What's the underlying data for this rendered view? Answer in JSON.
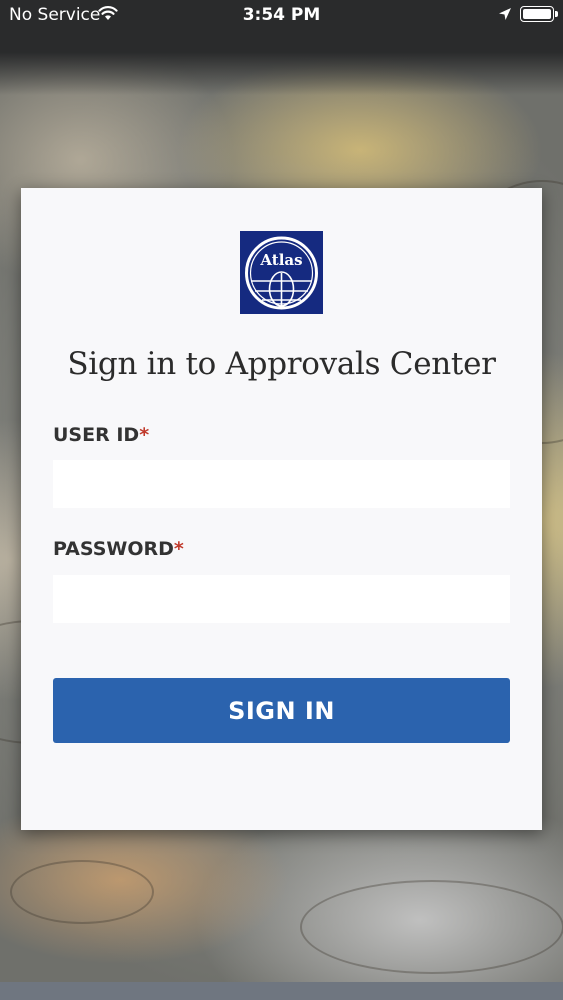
{
  "status_bar": {
    "carrier": "No Service",
    "time": "3:54 PM",
    "icons": [
      "wifi-icon",
      "location-arrow-icon",
      "battery-icon"
    ]
  },
  "login_card": {
    "logo_text": "Atlas",
    "title": "Sign in to Approvals Center",
    "user_id": {
      "label": "USER ID",
      "required_mark": "*",
      "value": ""
    },
    "password": {
      "label": "PASSWORD",
      "required_mark": "*",
      "value": ""
    },
    "sign_in_label": "SIGN IN"
  },
  "colors": {
    "primary_button": "#2b63ae",
    "logo_background": "#152a80",
    "required_mark": "#c0392b"
  }
}
